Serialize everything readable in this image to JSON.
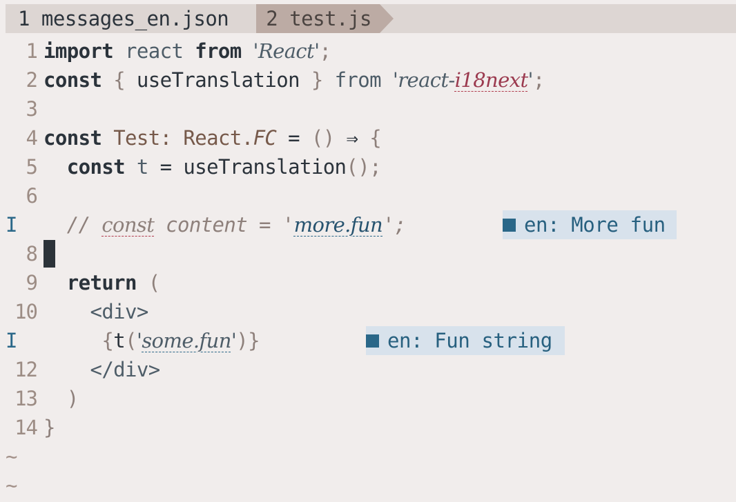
{
  "tabs": [
    {
      "label": "1 messages_en.json",
      "active": false
    },
    {
      "label": "2 test.js",
      "active": true
    }
  ],
  "gutter": {
    "line_numbers": [
      "1",
      "2",
      "3",
      "4",
      "5",
      "6",
      "I",
      "8",
      "9",
      "10",
      "I",
      "12",
      "13",
      "14"
    ],
    "sign_glyph": "I",
    "empty_marker": "~"
  },
  "code": {
    "l1": {
      "import": "import",
      "react": " react ",
      "from": "from",
      "space": " ",
      "str": "'React'",
      "semi": ";"
    },
    "l2": {
      "const": "const",
      "sp1": " ",
      "lbrace": "{",
      "name": " useTranslation ",
      "rbrace": "}",
      "from": " from ",
      "q1": "'",
      "str_a": "react-",
      "str_b": "i18next",
      "q2": "'",
      "semi": ";"
    },
    "l4": {
      "const": "const",
      "sp": " ",
      "name": "Test",
      "colon": ": ",
      "react": "React",
      "dot": ".",
      "fc": "FC",
      "eq": " = ",
      "parens": "()",
      "arrow": " ⇒ ",
      "lbrace": "{"
    },
    "l5": {
      "indent": "  ",
      "const": "const",
      "t": " t",
      "eq": " = ",
      "fn": "useTranslation",
      "parens": "()",
      "semi": ";"
    },
    "l7": {
      "indent": "  ",
      "slashes": "// ",
      "const": "const",
      "rest": " content = ",
      "q1": "'",
      "key": "more.fun",
      "q2": "'",
      "semi": ";"
    },
    "l9": {
      "indent": "  ",
      "return": "return",
      "paren": " ("
    },
    "l10": {
      "indent": "    ",
      "tag": "<div>"
    },
    "l11": {
      "indent": "     ",
      "lbrace": "{",
      "t": "t",
      "lparen": "(",
      "q1": "'",
      "key": "some.fun",
      "q2": "'",
      "rparen": ")",
      "rbrace": "}"
    },
    "l12": {
      "indent": "    ",
      "tag": "</div>"
    },
    "l13": {
      "indent": "  ",
      "paren": ")"
    },
    "l14": {
      "brace": "}"
    }
  },
  "virtual_text": [
    {
      "line": 7,
      "text": "en: More fun"
    },
    {
      "line": 11,
      "text": "en: Fun string"
    }
  ],
  "colors": {
    "background": "#f1edec",
    "tabline": "#ddd6d3",
    "active_tab": "#bcaba4",
    "virtual_text_bg": "#d8e2ec",
    "virtual_text_fg": "#27607f",
    "error_fg": "#9b3a4f"
  }
}
